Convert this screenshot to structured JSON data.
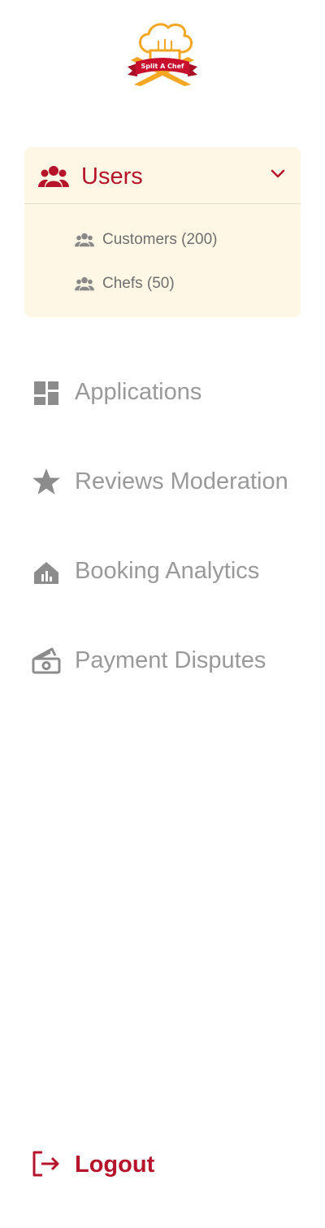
{
  "brand": {
    "logo_text": "Split A Chef",
    "colors": {
      "primary": "#b5142a",
      "accent": "#f5a623",
      "panel_bg": "#fef7e6",
      "muted": "#999999"
    }
  },
  "sidebar": {
    "users": {
      "label": "Users",
      "icon": "users-icon",
      "expanded": true,
      "children": [
        {
          "label": "Customers (200)",
          "icon": "users-icon"
        },
        {
          "label": "Chefs (50)",
          "icon": "users-icon"
        }
      ]
    },
    "items": [
      {
        "label": "Applications",
        "icon": "dashboard-icon"
      },
      {
        "label": "Reviews Moderation",
        "icon": "star-icon"
      },
      {
        "label": "Booking Analytics",
        "icon": "analytics-icon"
      },
      {
        "label": "Payment Disputes",
        "icon": "money-icon"
      }
    ],
    "logout": {
      "label": "Logout",
      "icon": "logout-icon"
    }
  }
}
